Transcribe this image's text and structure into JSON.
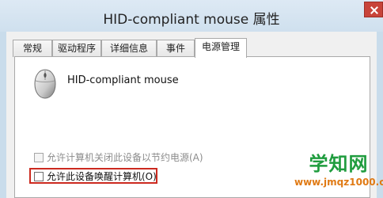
{
  "window": {
    "title": "HID-compliant mouse 属性"
  },
  "tabs": [
    {
      "label": "常规"
    },
    {
      "label": "驱动程序"
    },
    {
      "label": "详细信息"
    },
    {
      "label": "事件"
    },
    {
      "label": "电源管理"
    }
  ],
  "active_tab": "电源管理",
  "device": {
    "name": "HID-compliant mouse",
    "icon": "mouse-icon"
  },
  "power": {
    "allow_power_off_label": "允许计算机关闭此设备以节约电源(A)",
    "allow_power_off_checked": false,
    "allow_power_off_enabled": false,
    "allow_wake_label": "允许此设备唤醒计算机(O)",
    "allow_wake_checked": false,
    "allow_wake_enabled": true
  },
  "watermark": {
    "main": "学知网",
    "sub": "www.jmqz1000.com"
  },
  "colors": {
    "highlight": "#cc2a1f",
    "watermark_green": "#1f9c3e",
    "watermark_orange": "#e07a14"
  }
}
